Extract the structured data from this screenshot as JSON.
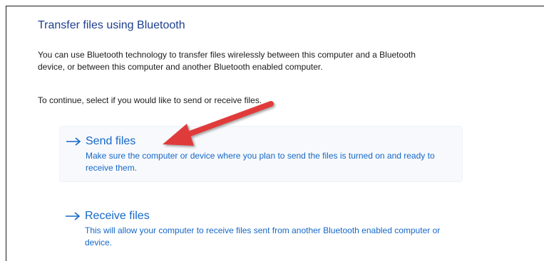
{
  "dialog": {
    "title": "Transfer files using Bluetooth",
    "description": "You can use Bluetooth technology to transfer files wirelessly between this computer and a Bluetooth device, or between this computer and another Bluetooth enabled computer.",
    "prompt": "To continue, select if you would like to send or receive files."
  },
  "options": [
    {
      "label": "Send files",
      "description": "Make sure the computer or device where you plan to send the files is turned on and ready to receive them.",
      "icon": "arrow-right-icon"
    },
    {
      "label": "Receive files",
      "description": "This will allow your computer to receive files sent from another Bluetooth enabled computer or device.",
      "icon": "arrow-right-icon"
    }
  ],
  "annotation": {
    "icon": "red-callout-arrow",
    "color": "#e03a3a"
  },
  "colors": {
    "title": "#1e3f8f",
    "link": "#1568c8",
    "text": "#1b1b1b"
  }
}
